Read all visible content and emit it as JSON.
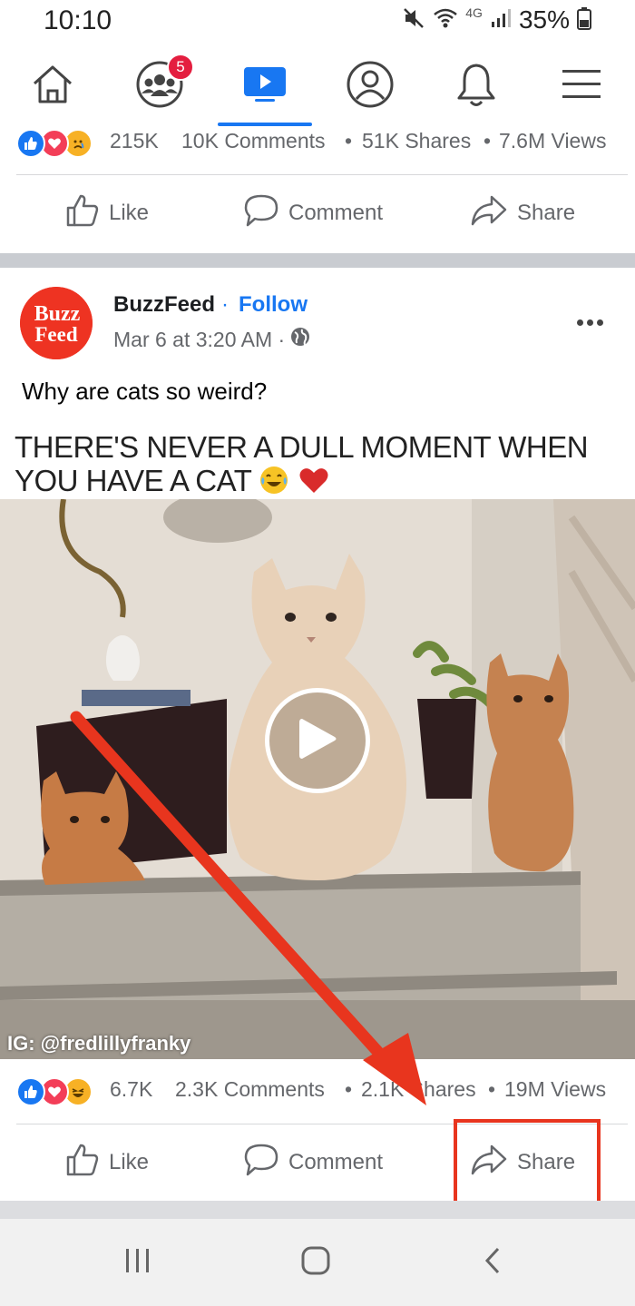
{
  "status_bar": {
    "time": "10:10",
    "network": "4G",
    "battery": "35%"
  },
  "nav": {
    "items": [
      {
        "icon": "home-icon"
      },
      {
        "icon": "groups-icon",
        "badge": "5"
      },
      {
        "icon": "watch-icon",
        "active": true
      },
      {
        "icon": "profile-icon"
      },
      {
        "icon": "bell-icon"
      },
      {
        "icon": "menu-icon"
      }
    ],
    "accent": "#1877f2",
    "badge_color": "#e41e3f"
  },
  "prev_post": {
    "reactions_count": "215K",
    "comments": "10K Comments",
    "shares": "51K Shares",
    "views": "7.6M Views",
    "separator": "•"
  },
  "actions": {
    "like": "Like",
    "comment": "Comment",
    "share": "Share"
  },
  "post": {
    "avatar_text_1": "Buzz",
    "avatar_text_2": "Feed",
    "author": "BuzzFeed",
    "follow_dot": "·",
    "follow": "Follow",
    "date": "Mar 6 at 3:20 AM ·",
    "text": "Why are cats so weird?",
    "video_caption": "THERE'S NEVER A DULL MOMENT WHEN YOU HAVE A CAT",
    "video_watermark": "IG: @fredlillyfranky",
    "reactions_count": "6.7K",
    "comments": "2.3K Comments",
    "shares": "2.1K Shares",
    "views": "19M Views",
    "separator": "•"
  },
  "annotation": {
    "color": "#e8351e",
    "target": "share-button"
  },
  "android_nav": {
    "items": [
      "recents-icon",
      "home-button-icon",
      "back-icon"
    ]
  }
}
